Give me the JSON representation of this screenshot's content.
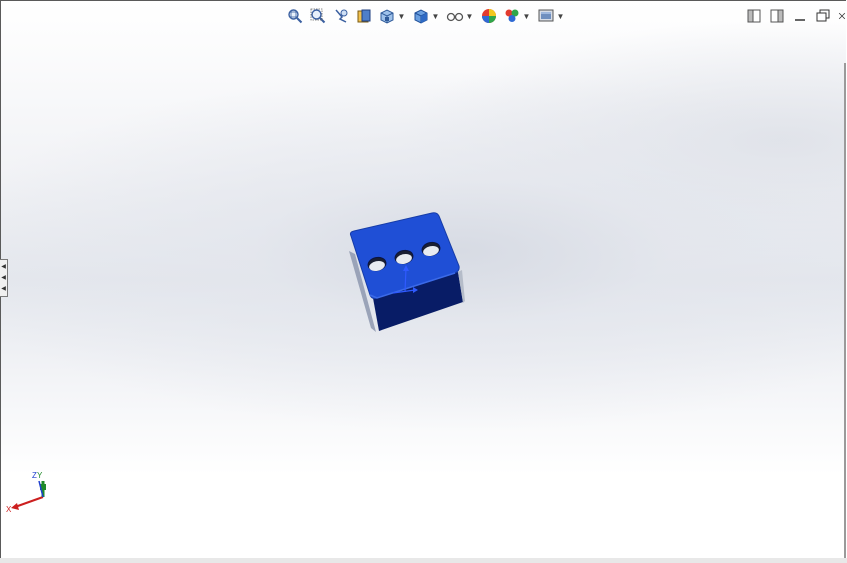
{
  "heads_up_toolbar": {
    "items": [
      {
        "icon": "zoom-to-fit-icon",
        "dropdown": false
      },
      {
        "icon": "zoom-to-area-icon",
        "dropdown": false
      },
      {
        "icon": "previous-view-icon",
        "dropdown": false
      },
      {
        "icon": "section-view-icon",
        "dropdown": false
      },
      {
        "icon": "view-orientation-icon",
        "dropdown": true
      },
      {
        "icon": "display-style-icon",
        "dropdown": true
      },
      {
        "icon": "hide-show-items-icon",
        "dropdown": true
      },
      {
        "icon": "edit-appearance-icon",
        "dropdown": false
      },
      {
        "icon": "apply-scene-icon",
        "dropdown": true
      },
      {
        "icon": "view-settings-icon",
        "dropdown": true
      }
    ]
  },
  "window_controls": [
    "tile-left-icon",
    "tile-right-icon",
    "minimize-icon",
    "restore-icon",
    "close-icon"
  ],
  "triad": {
    "x_label": "X",
    "y_label": "Y",
    "z_label": "Z"
  },
  "colors": {
    "model_top": "#1f4fd6",
    "model_side": "#071a63",
    "triad_x": "#cc1f1f",
    "triad_y": "#1f8a2a",
    "triad_z": "#1f3fd0"
  }
}
